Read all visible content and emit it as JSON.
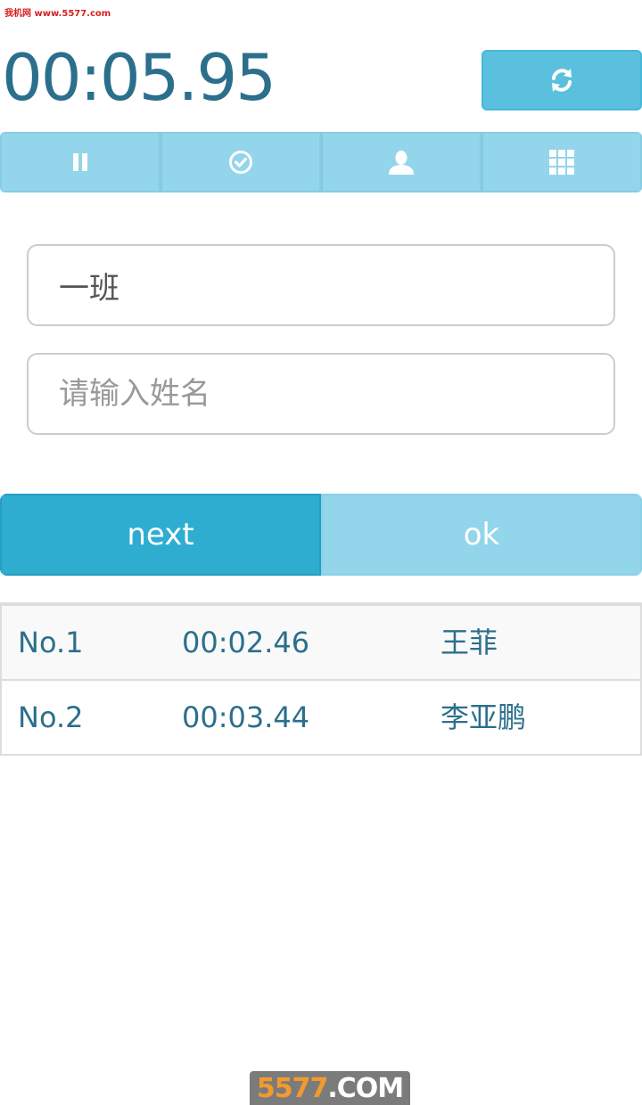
{
  "watermark_top": "我机网 www.5577.com",
  "timer": {
    "value": "00:05.95"
  },
  "toolbar": {
    "items": [
      {
        "icon": "pause-icon"
      },
      {
        "icon": "check-circle-icon"
      },
      {
        "icon": "user-icon"
      },
      {
        "icon": "grid-icon"
      }
    ]
  },
  "form": {
    "class_value": "一班",
    "name_placeholder": "请输入姓名"
  },
  "actions": {
    "next_label": "next",
    "ok_label": "ok"
  },
  "records": [
    {
      "no": "No.1",
      "time": "00:02.46",
      "name": "王菲"
    },
    {
      "no": "No.2",
      "time": "00:03.44",
      "name": "李亚鹏"
    }
  ],
  "watermark_bottom": {
    "num": "5577",
    "dom": ".COM"
  },
  "colors": {
    "accent": "#5bc0de",
    "accent_dark": "#2eadd1",
    "accent_light": "#93d5ea",
    "timer_text": "#2c6f8c"
  }
}
